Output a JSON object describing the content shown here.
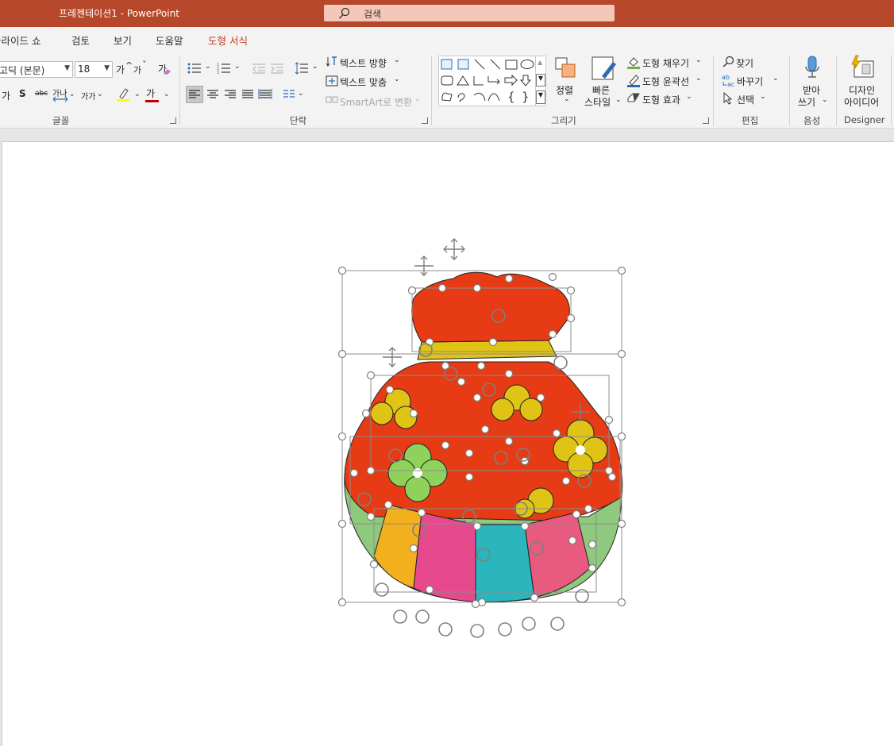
{
  "titlebar": {
    "doc_title": "프레젠테이션1  -  PowerPoint",
    "search_placeholder": "검색",
    "bg_color": "#b7472a"
  },
  "tabs": [
    {
      "label": "슬라이드 쇼"
    },
    {
      "label": "검토"
    },
    {
      "label": "보기"
    },
    {
      "label": "도움말"
    },
    {
      "label": "도형 서식",
      "active": true
    }
  ],
  "ribbon": {
    "font": {
      "font_name": "고딕 (본문)",
      "font_size": "18",
      "grow": "가",
      "shrink": "가",
      "clear": "가",
      "underline": "가",
      "shadow": "S",
      "strike": "abc",
      "spacing": "가나",
      "case": "가가",
      "color_label": "가",
      "group_label": "글꼴"
    },
    "paragraph": {
      "text_direction": "텍스트 방향",
      "align_text": "텍스트 맞춤",
      "smartart": "SmartArt로 변환",
      "group_label": "단락"
    },
    "drawing": {
      "arrange": "정렬",
      "quick_styles_1": "빠른",
      "quick_styles_2": "스타일",
      "fill": "도형 채우기",
      "outline": "도형 윤곽선",
      "effects": "도형 효과",
      "group_label": "그리기"
    },
    "editing": {
      "find": "찾기",
      "replace": "바꾸기",
      "select": "선택",
      "group_label": "편집"
    },
    "voice": {
      "dictate_1": "받아",
      "dictate_2": "쓰기",
      "group_label": "음성"
    },
    "designer": {
      "ideas_1": "디자인",
      "ideas_2": "아이디어",
      "group_label": "Designer"
    }
  },
  "colors": {
    "accent": "#c43e1c",
    "pouch_red": "#e63b14",
    "pouch_yellow": "#e0c415",
    "pouch_green": "#8fc97d",
    "pouch_orange": "#f2b01e",
    "pouch_pink": "#e6498c",
    "pouch_teal": "#2bb5bd",
    "pouch_rose": "#e85a7f",
    "flower_green": "#8ed25b",
    "highlight_yellow": "#ffff00",
    "font_red": "#c00000"
  }
}
